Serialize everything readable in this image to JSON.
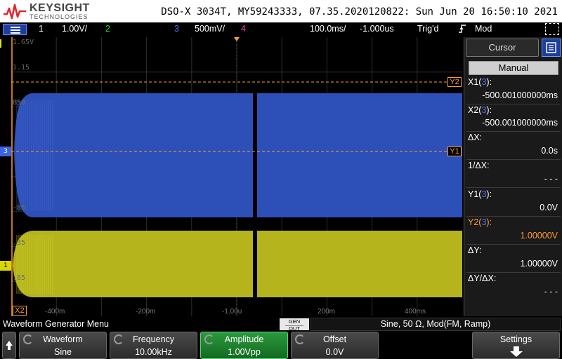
{
  "header": {
    "brand": "KEYSIGHT",
    "brand_sub": "TECHNOLOGIES",
    "device_info": "DSO-X 3034T, MY59243333, 07.35.2020120822: Sun Jun 20 16:50:10 2021"
  },
  "status_bar": {
    "ch1_num": "1",
    "ch1_scale": "1.00V/",
    "ch2_num": "2",
    "ch3_num": "3",
    "ch3_scale": "500mV/",
    "ch4_num": "4",
    "timebase": "100.0ms/",
    "delay": "-1.000us",
    "trigger_state": "Trig'd",
    "trigger_mode": "Mod",
    "colors": {
      "ch1": "#e6e600",
      "ch2": "#2fd12f",
      "ch3": "#4a73ff",
      "ch4": "#ff3fa3"
    }
  },
  "grid": {
    "y_labels": [
      "1.65V",
      "1.15",
      "850",
      "-85",
      ".35",
      ".85"
    ],
    "x_labels": [
      "-400m",
      "-200m",
      "-1.00u",
      "200m",
      "400ms"
    ],
    "cursor_y2_label": "Y2",
    "cursor_y1_label": "Y1",
    "cursor_x2_label": "X2",
    "ch3_marker": "3",
    "ch1_marker": "1"
  },
  "side_panel": {
    "title": "Cursor",
    "mode": "Manual",
    "x1_label": "X1(",
    "x1_src": "3",
    "x1_label_end": "):",
    "x1_value": "-500.001000000ms",
    "x2_label": "X2(",
    "x2_src": "3",
    "x2_label_end": "):",
    "x2_value": "-500.001000000ms",
    "dx_label": "ΔX:",
    "dx_value": "0.0s",
    "inv_dx_label": "1/ΔX:",
    "inv_dx_value": "- - -",
    "y1_label": "Y1(",
    "y1_src": "3",
    "y1_label_end": "):",
    "y1_value": "0.0V",
    "y2_label": "Y2(",
    "y2_src": "3",
    "y2_label_end": "):",
    "y2_value": "1.00000V",
    "dy_label": "ΔY:",
    "dy_value": "1.00000V",
    "dy_dx_label": "ΔY/ΔX:",
    "dy_dx_value": "- - -"
  },
  "menu_strip": {
    "title": "Waveform Generator Menu",
    "gen_out_line1": "GEN",
    "gen_out_line2": "OUT",
    "status": "Sine, 50 Ω, Mod(FM, Ramp)"
  },
  "softkeys": [
    {
      "label": "Waveform",
      "value": "Sine"
    },
    {
      "label": "Frequency",
      "value": "10.00kHz"
    },
    {
      "label": "Amplitude",
      "value": "1.00Vpp"
    },
    {
      "label": "Offset",
      "value": "0.0V"
    },
    {
      "label": "Settings",
      "value": ""
    }
  ]
}
